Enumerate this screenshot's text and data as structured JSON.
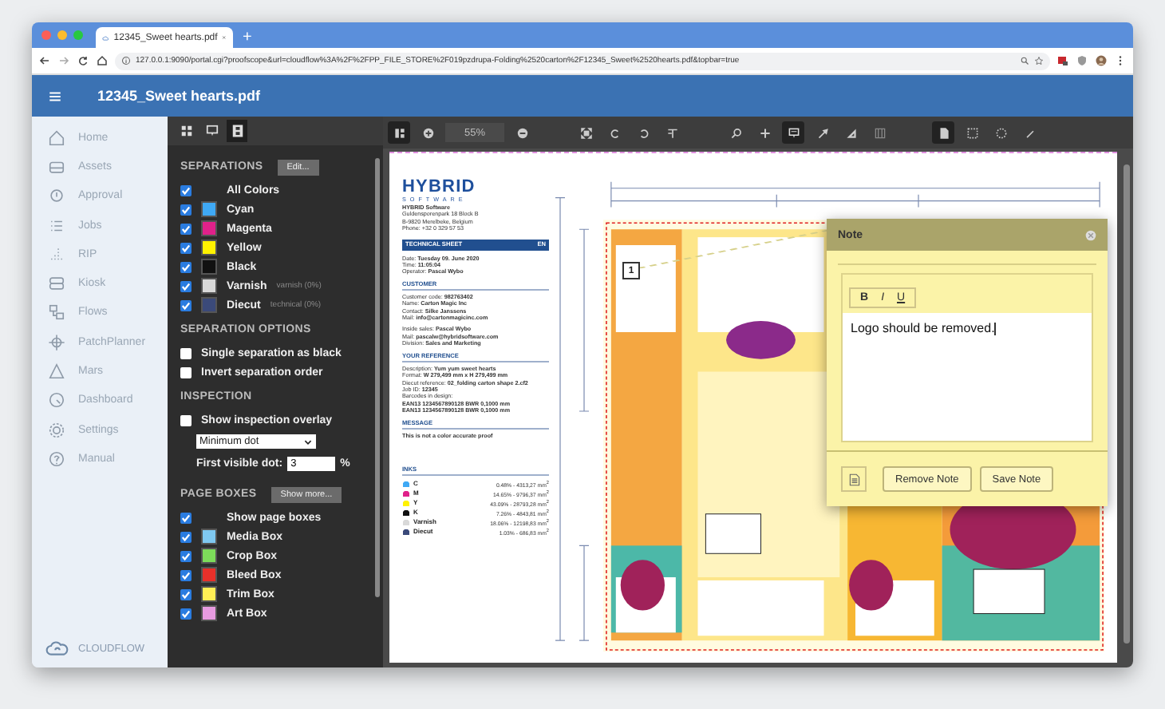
{
  "browser": {
    "tab_title": "12345_Sweet hearts.pdf",
    "new_tab": "+",
    "url": "127.0.0.1:9090/portal.cgi?proofscope&url=cloudflow%3A%2F%2FPP_FILE_STORE%2F019pzdrupa-Folding%2520carton%2F12345_Sweet%2520hearts.pdf&topbar=true"
  },
  "app": {
    "title": "12345_Sweet hearts.pdf"
  },
  "sidebar": {
    "items": [
      {
        "label": "Home"
      },
      {
        "label": "Assets"
      },
      {
        "label": "Approval"
      },
      {
        "label": "Jobs"
      },
      {
        "label": "RIP"
      },
      {
        "label": "Kiosk"
      },
      {
        "label": "Flows"
      },
      {
        "label": "PatchPlanner"
      },
      {
        "label": "Mars"
      },
      {
        "label": "Dashboard"
      },
      {
        "label": "Settings"
      },
      {
        "label": "Manual"
      }
    ],
    "brand": "CLOUDFLOW"
  },
  "panel": {
    "tabs": [
      {
        "selected": false
      },
      {
        "selected": false
      },
      {
        "selected": true
      }
    ],
    "separations": {
      "title": "SEPARATIONS",
      "button": "Edit...",
      "all": {
        "label": "All Colors",
        "checked": true
      },
      "items": [
        {
          "name": "Cyan",
          "color": "#3fa9f5",
          "checked": true
        },
        {
          "name": "Magenta",
          "color": "#e0218a",
          "checked": true
        },
        {
          "name": "Yellow",
          "color": "#fff200",
          "checked": true
        },
        {
          "name": "Black",
          "color": "#111111",
          "checked": true
        },
        {
          "name": "Varnish",
          "color": "#d9d9d9",
          "checked": true,
          "note": "varnish (0%)"
        },
        {
          "name": "Diecut",
          "color": "#3b4a7a",
          "checked": true,
          "note": "technical (0%)"
        }
      ]
    },
    "separation_options": {
      "title": "SEPARATION OPTIONS",
      "items": [
        {
          "label": "Single separation as black",
          "checked": false
        },
        {
          "label": "Invert separation order",
          "checked": false
        }
      ]
    },
    "inspection": {
      "title": "INSPECTION",
      "overlay": {
        "label": "Show inspection overlay",
        "checked": false
      },
      "select": "Minimum dot",
      "dot_label": "First visible dot:",
      "dot_value": "3",
      "dot_unit": "%"
    },
    "page_boxes": {
      "title": "PAGE BOXES",
      "button": "Show more...",
      "all": {
        "label": "Show page boxes",
        "checked": true
      },
      "items": [
        {
          "name": "Media Box",
          "color": "#7fc8f0",
          "checked": true
        },
        {
          "name": "Crop Box",
          "color": "#7ddc5a",
          "checked": true
        },
        {
          "name": "Bleed Box",
          "color": "#e8302a",
          "checked": true
        },
        {
          "name": "Trim Box",
          "color": "#ffee55",
          "checked": true
        },
        {
          "name": "Art Box",
          "color": "#e79be0",
          "checked": true
        }
      ]
    }
  },
  "toolbar": {
    "zoom_value": "55%",
    "tools": [
      {
        "selected": true
      },
      {
        "selected": false
      },
      {
        "selected": false
      },
      {
        "selected": false
      },
      {
        "selected": false
      },
      {
        "selected": false
      },
      {
        "selected": false
      },
      {
        "selected": false
      },
      {
        "selected": false
      },
      {
        "selected": true
      },
      {
        "selected": false
      },
      {
        "selected": false
      },
      {
        "selected": false
      },
      {
        "selected": true
      },
      {
        "selected": false
      },
      {
        "selected": false
      },
      {
        "selected": false
      }
    ]
  },
  "sheet": {
    "logo": "HYBRID",
    "logo_sub": "SOFTWARE",
    "address": [
      "HYBRID Software",
      "Guldensporenpark 18 Block B",
      "B-9820 Merelbeke, Belgium",
      "Phone: +32 0 329 57 53"
    ],
    "banner": "TECHNICAL SHEET",
    "banner_lang": "EN",
    "sections": [
      {
        "lines": [
          "Date: **Tuesday 09. June 2020**",
          "Time: **11:05:04**",
          "Operator: **Pascal Wybo**"
        ]
      },
      {
        "heading": "CUSTOMER",
        "lines": [
          "Customer code: **982763402**",
          "Name: **Carton Magic Inc**",
          "Contact: **Silke Janssens**",
          "Mail: **info@cartonmagicinc.com**"
        ]
      },
      {
        "lines": [
          "Inside sales: **Pascal Wybo**",
          "Mail: **pascalw@hybridsoftware.com**",
          "Division: **Sales and Marketing**"
        ]
      },
      {
        "heading": "YOUR REFERENCE",
        "lines": [
          "Description: **Yum yum sweet hearts**",
          "Format: **W 279,499 mm x H 279,499 mm**",
          "Diecut reference: **02_folding carton shape 2.cf2**",
          "Job ID: **12345**",
          "Barcodes in design:",
          "**EAN13 1234567890128 BWR 0,1000 mm**",
          "**EAN13 1234567890128 BWR 0,1000 mm**"
        ]
      },
      {
        "heading": "MESSAGE",
        "lines": [
          "**This is not a color accurate proof**"
        ]
      }
    ],
    "inks_heading": "INKS",
    "inks": [
      {
        "name": "C",
        "color": "#3fa9f5",
        "value": "0.48% - 4313,27 mm$^{2}$"
      },
      {
        "name": "M",
        "color": "#e0218a",
        "value": "14.65% - 9796,37 mm$^{2}$"
      },
      {
        "name": "Y",
        "color": "#fff200",
        "value": "43.09% - 28793,28 mm$^{2}$"
      },
      {
        "name": "K",
        "color": "#111111",
        "value": "7.26% - 4843,81 mm$^{2}$"
      },
      {
        "name": "Varnish",
        "color": "#d9d9d9",
        "value": "18.06% - 12198,83 mm$^{2}$"
      },
      {
        "name": "Diecut",
        "color": "#3b4a7a",
        "value": "1.03% - 686,83 mm$^{2}$"
      }
    ]
  },
  "pin": {
    "label": "1"
  },
  "note": {
    "title": "Note",
    "format_buttons": [
      "B",
      "I",
      "U"
    ],
    "text": "Logo should be removed.",
    "buttons": [
      "Remove Note",
      "Save Note"
    ]
  }
}
